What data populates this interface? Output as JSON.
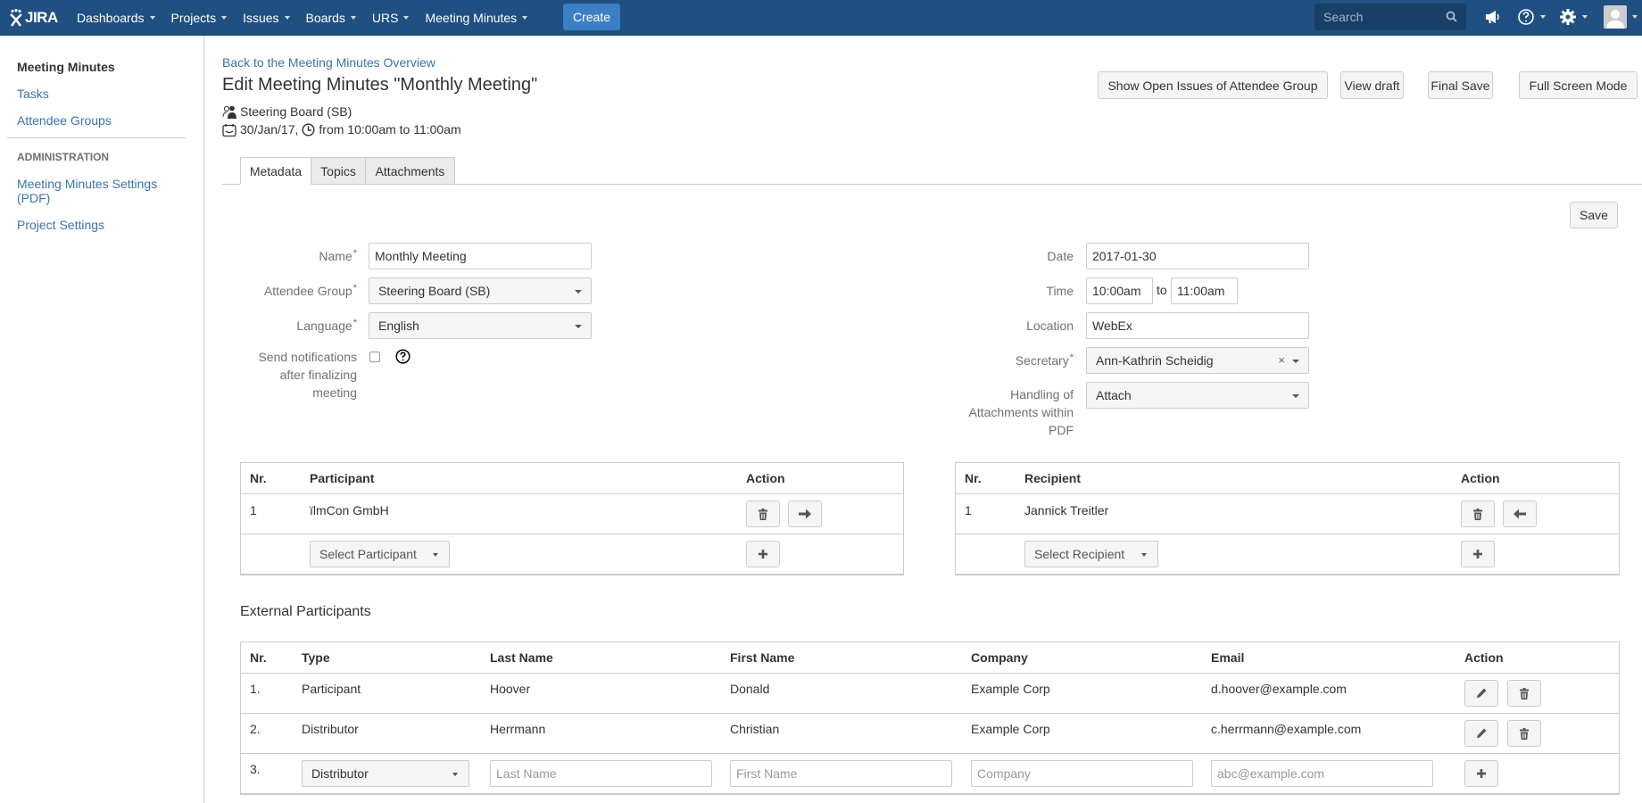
{
  "header": {
    "logo": "JIRA",
    "nav": [
      {
        "label": "Dashboards"
      },
      {
        "label": "Projects"
      },
      {
        "label": "Issues"
      },
      {
        "label": "Boards"
      },
      {
        "label": "URS"
      },
      {
        "label": "Meeting Minutes"
      }
    ],
    "create_label": "Create",
    "search_placeholder": "Search",
    "icons": [
      "notifications-icon",
      "help-icon",
      "settings-icon",
      "avatar"
    ]
  },
  "sidebar": {
    "title": "Meeting Minutes",
    "items": [
      {
        "label": "Tasks"
      },
      {
        "label": "Attendee Groups"
      }
    ],
    "section_label": "ADMINISTRATION",
    "admin_items": [
      {
        "label": "Meeting Minutes Settings (PDF)"
      },
      {
        "label": "Project Settings"
      }
    ]
  },
  "main": {
    "back_link": "Back to the Meeting Minutes Overview",
    "title": "Edit Meeting Minutes \"Monthly Meeting\"",
    "group": "Steering Board (SB)",
    "date_text": "30/Jan/17,",
    "time_text": "from 10:00am to 11:00am",
    "buttons": {
      "show_open_issues": "Show Open Issues of Attendee Group",
      "view_draft": "View draft",
      "final_save": "Final Save",
      "full_screen": "Full Screen Mode"
    },
    "tabs": [
      {
        "label": "Metadata",
        "active": true
      },
      {
        "label": "Topics",
        "active": false
      },
      {
        "label": "Attachments",
        "active": false
      }
    ],
    "save_label": "Save"
  },
  "form": {
    "name": {
      "label": "Name",
      "value": "Monthly Meeting",
      "required": true
    },
    "attendee_group": {
      "label": "Attendee Group",
      "value": "Steering Board (SB)",
      "required": true
    },
    "language": {
      "label": "Language",
      "value": "English",
      "required": true
    },
    "notifications": {
      "label_lines": [
        "Send notifications",
        "after finalizing",
        "meeting"
      ],
      "checked": false
    },
    "date": {
      "label": "Date",
      "value": "2017-01-30"
    },
    "time": {
      "label": "Time",
      "from": "10:00am",
      "separator": "to",
      "to": "11:00am"
    },
    "location": {
      "label": "Location",
      "value": "WebEx"
    },
    "secretary": {
      "label": "Secretary",
      "value": "Ann-Kathrin Scheidig",
      "required": true
    },
    "attachments_handling": {
      "label_lines": [
        "Handling of",
        "Attachments within",
        "PDF"
      ],
      "value": "Attach"
    }
  },
  "participants": {
    "headers": [
      "Nr.",
      "Participant",
      "Action"
    ],
    "rows": [
      {
        "nr": "1",
        "name": "ïlmCon GmbH"
      }
    ],
    "select_placeholder": "Select Participant"
  },
  "recipients": {
    "headers": [
      "Nr.",
      "Recipient",
      "Action"
    ],
    "rows": [
      {
        "nr": "1",
        "name": "Jannick Treitler"
      }
    ],
    "select_placeholder": "Select Recipient"
  },
  "external": {
    "title": "External Participants",
    "headers": [
      "Nr.",
      "Type",
      "Last Name",
      "First Name",
      "Company",
      "Email",
      "Action"
    ],
    "rows": [
      {
        "nr": "1.",
        "type": "Participant",
        "last": "Hoover",
        "first": "Donald",
        "company": "Example Corp",
        "email": "d.hoover@example.com"
      },
      {
        "nr": "2.",
        "type": "Distributor",
        "last": "Herrmann",
        "first": "Christian",
        "company": "Example Corp",
        "email": "c.herrmann@example.com"
      }
    ],
    "new_row": {
      "nr": "3.",
      "type": "Distributor",
      "last_placeholder": "Last Name",
      "first_placeholder": "First Name",
      "company_placeholder": "Company",
      "email_placeholder": "abc@example.com"
    }
  },
  "colors": {
    "header_bg": "#205081",
    "create_btn": "#3b7fc4",
    "link": "#3b73af",
    "required": "#d04437"
  }
}
